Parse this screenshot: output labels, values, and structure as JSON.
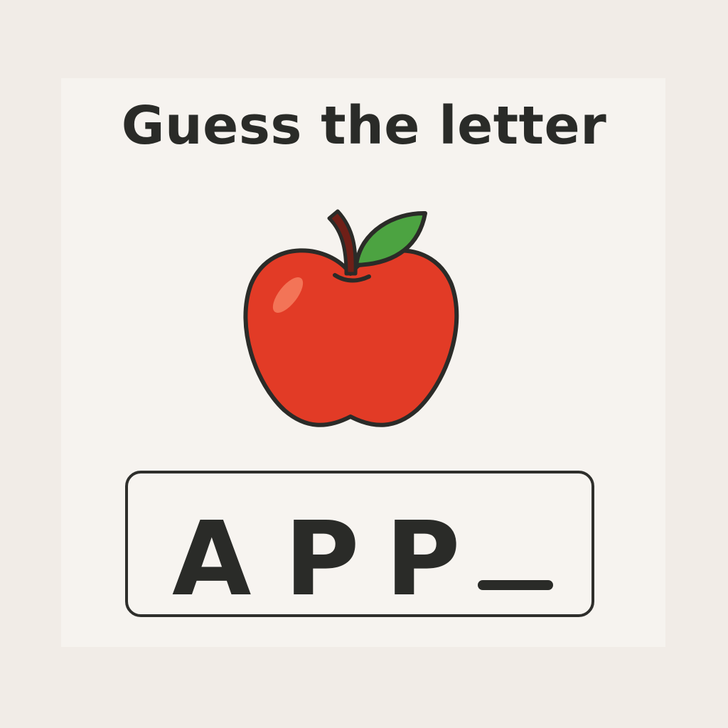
{
  "game": {
    "title": "Guess the letter",
    "picture_icon": "apple-icon",
    "word_letters": [
      "A",
      "P",
      "P"
    ],
    "blank_count": 1
  },
  "colors": {
    "background": "#f1ece7",
    "card": "#f6f3ef",
    "text": "#2a2b28",
    "apple_red": "#e23b26",
    "leaf_green": "#4ca341",
    "stem_brown": "#6f1f17"
  }
}
